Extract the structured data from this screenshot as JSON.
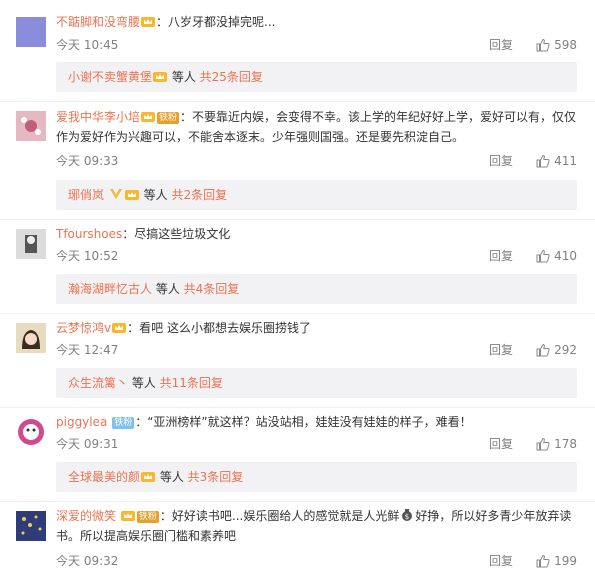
{
  "comments": [
    {
      "user": "不踮脚和没弯腰",
      "colon": "：",
      "text": "八岁牙都没掉完呢...",
      "time": "今天 10:45",
      "reply_label": "回复",
      "likes": "598",
      "sub_user": "小谢不卖蟹黄堡",
      "sub_mid": " 等人 ",
      "sub_count": "共25条回复",
      "avatar_color": "#8a8ddc"
    },
    {
      "user": "爱我中华李小培",
      "fan_badge": "铁粉",
      "colon": "：",
      "text": "不要靠近内娱，会变得不幸。该上学的年纪好好上学，爱好可以有，仅仅作为爱好作为兴趣可以，不能舍本逐末。少年强则国强。还是要先积淀自己。",
      "time": "今天 09:33",
      "reply_label": "回复",
      "likes": "411",
      "sub_user": "琊俏岚",
      "sub_mid": " 等人 ",
      "sub_count": "共2条回复",
      "avatar_color": "#e6b8c2"
    },
    {
      "user": "Tfourshoes",
      "colon": "：",
      "text": "尽搞这些垃圾文化",
      "time": "今天 10:52",
      "reply_label": "回复",
      "likes": "410",
      "sub_user": "瀚海湖畔忆古人",
      "sub_mid": " 等人 ",
      "sub_count": "共4条回复",
      "avatar_color": "#c9c9c9"
    },
    {
      "user": "云梦惊鸿v",
      "colon": "：",
      "text": "看吧 这么小都想去娱乐圈捞钱了",
      "time": "今天 12:47",
      "reply_label": "回复",
      "likes": "292",
      "sub_user": "众生流篱丶",
      "sub_mid": " 等人 ",
      "sub_count": "共11条回复",
      "avatar_color": "#d8c9a8"
    },
    {
      "user": "piggylea",
      "fan_badge": "铁粉",
      "colon": "：",
      "text": "“亚洲榜样”就这样？站没站相，娃娃没有娃娃的样子，难看！",
      "time": "今天 09:31",
      "reply_label": "回复",
      "likes": "178",
      "sub_user": "全球最美的颜",
      "sub_mid": " 等人 ",
      "sub_count": "共3条回复",
      "avatar_color": "#d24a8a"
    },
    {
      "user": "深爱的微笑",
      "fan_badge": "铁粉",
      "colon": "：",
      "text_part1": "好好读书吧...娱乐圈给人的感觉就是人光鲜",
      "text_part2": "好挣，所以好多青少年放弃读书。所以提高娱乐圈门槛和素养吧",
      "time": "今天 09:32",
      "reply_label": "回复",
      "likes": "199",
      "avatar_color": "#3a4a8a"
    }
  ],
  "icons": {
    "like": "thumbs-up-icon",
    "vip": "crown-badge-icon",
    "money": "money-bag-icon"
  }
}
